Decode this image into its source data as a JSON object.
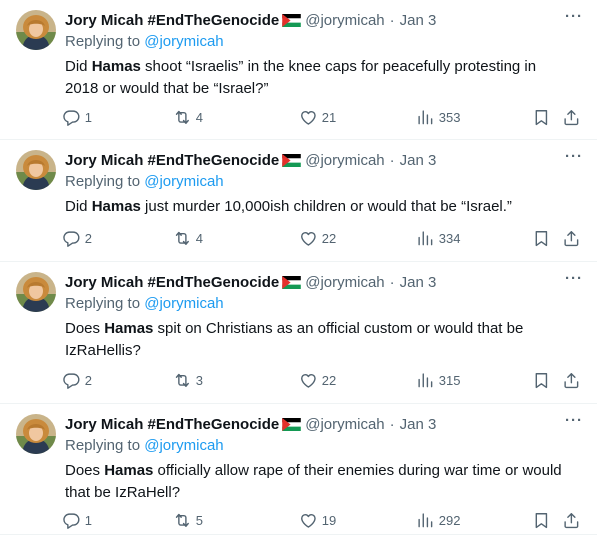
{
  "colors": {
    "text_primary": "#0f1419",
    "text_secondary": "#536471",
    "link": "#1d9bf0",
    "divider": "#eff3f4"
  },
  "icons": {
    "reply": "reply-icon",
    "retweet": "retweet-icon",
    "like": "heart-icon",
    "views": "views-icon",
    "bookmark": "bookmark-icon",
    "share": "share-icon",
    "more": "more-icon",
    "flag": "palestine-flag-icon"
  },
  "tweets": [
    {
      "display_name": "Jory Micah #EndTheGenocide",
      "handle": "@jorymicah",
      "dot": "·",
      "time": "Jan 3",
      "more": "···",
      "replying_prefix": "Replying to",
      "replying_handle": "@jorymicah",
      "text_pre": "Did ",
      "text_bold": "Hamas",
      "text_post": " shoot “Israelis” in the knee caps for peacefully protesting in 2018 or would that be “Israel?”",
      "replies": "1",
      "retweets": "4",
      "likes": "21",
      "views": "353"
    },
    {
      "display_name": "Jory Micah #EndTheGenocide",
      "handle": "@jorymicah",
      "dot": "·",
      "time": "Jan 3",
      "more": "···",
      "replying_prefix": "Replying to",
      "replying_handle": "@jorymicah",
      "text_pre": "Did ",
      "text_bold": "Hamas",
      "text_post": " just murder 10,000ish children or would that be “Israel.”",
      "replies": "2",
      "retweets": "4",
      "likes": "22",
      "views": "334"
    },
    {
      "display_name": "Jory Micah #EndTheGenocide",
      "handle": "@jorymicah",
      "dot": "·",
      "time": "Jan 3",
      "more": "···",
      "replying_prefix": "Replying to",
      "replying_handle": "@jorymicah",
      "text_pre": "Does ",
      "text_bold": "Hamas",
      "text_post": " spit on Christians as an official custom or would that be IzRaHellis?",
      "replies": "2",
      "retweets": "3",
      "likes": "22",
      "views": "315"
    },
    {
      "display_name": "Jory Micah #EndTheGenocide",
      "handle": "@jorymicah",
      "dot": "·",
      "time": "Jan 3",
      "more": "···",
      "replying_prefix": "Replying to",
      "replying_handle": "@jorymicah",
      "text_pre": "Does ",
      "text_bold": "Hamas",
      "text_post": " officially allow rape of their enemies during war time or would that be IzRaHell?",
      "replies": "1",
      "retweets": "5",
      "likes": "19",
      "views": "292"
    }
  ]
}
